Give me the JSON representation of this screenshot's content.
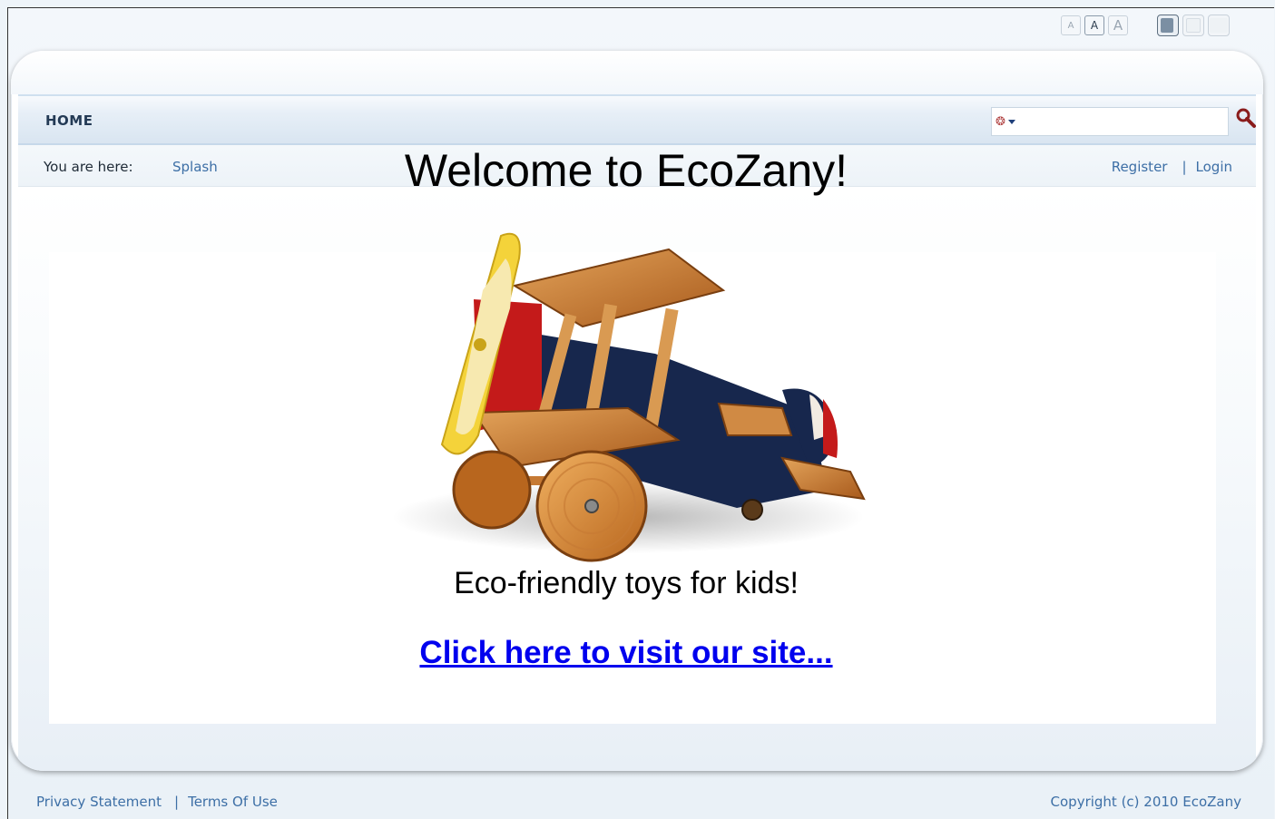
{
  "top_controls": {
    "font_size_small": "A",
    "font_size_medium": "A",
    "font_size_large": "A"
  },
  "nav": {
    "home_label": "HOME"
  },
  "search": {
    "value": "",
    "placeholder": "",
    "engine_icon": "site-search-engine-icon"
  },
  "breadcrumb": {
    "label": "You are here:",
    "current": "Splash"
  },
  "user_links": {
    "register": "Register",
    "separator": "|",
    "login": "Login"
  },
  "content": {
    "welcome": "Welcome to EcoZany!",
    "image_subject": "wooden toy biplane",
    "tagline": "Eco-friendly toys for kids!",
    "cta": "Click here to visit our site..."
  },
  "footer": {
    "privacy": "Privacy Statement",
    "separator": "|",
    "terms": "Terms Of Use",
    "copyright": "Copyright (c) 2010 EcoZany"
  },
  "colors": {
    "link": "#3d6fa6",
    "cta": "#0000ee",
    "nav_text": "#233a55"
  }
}
